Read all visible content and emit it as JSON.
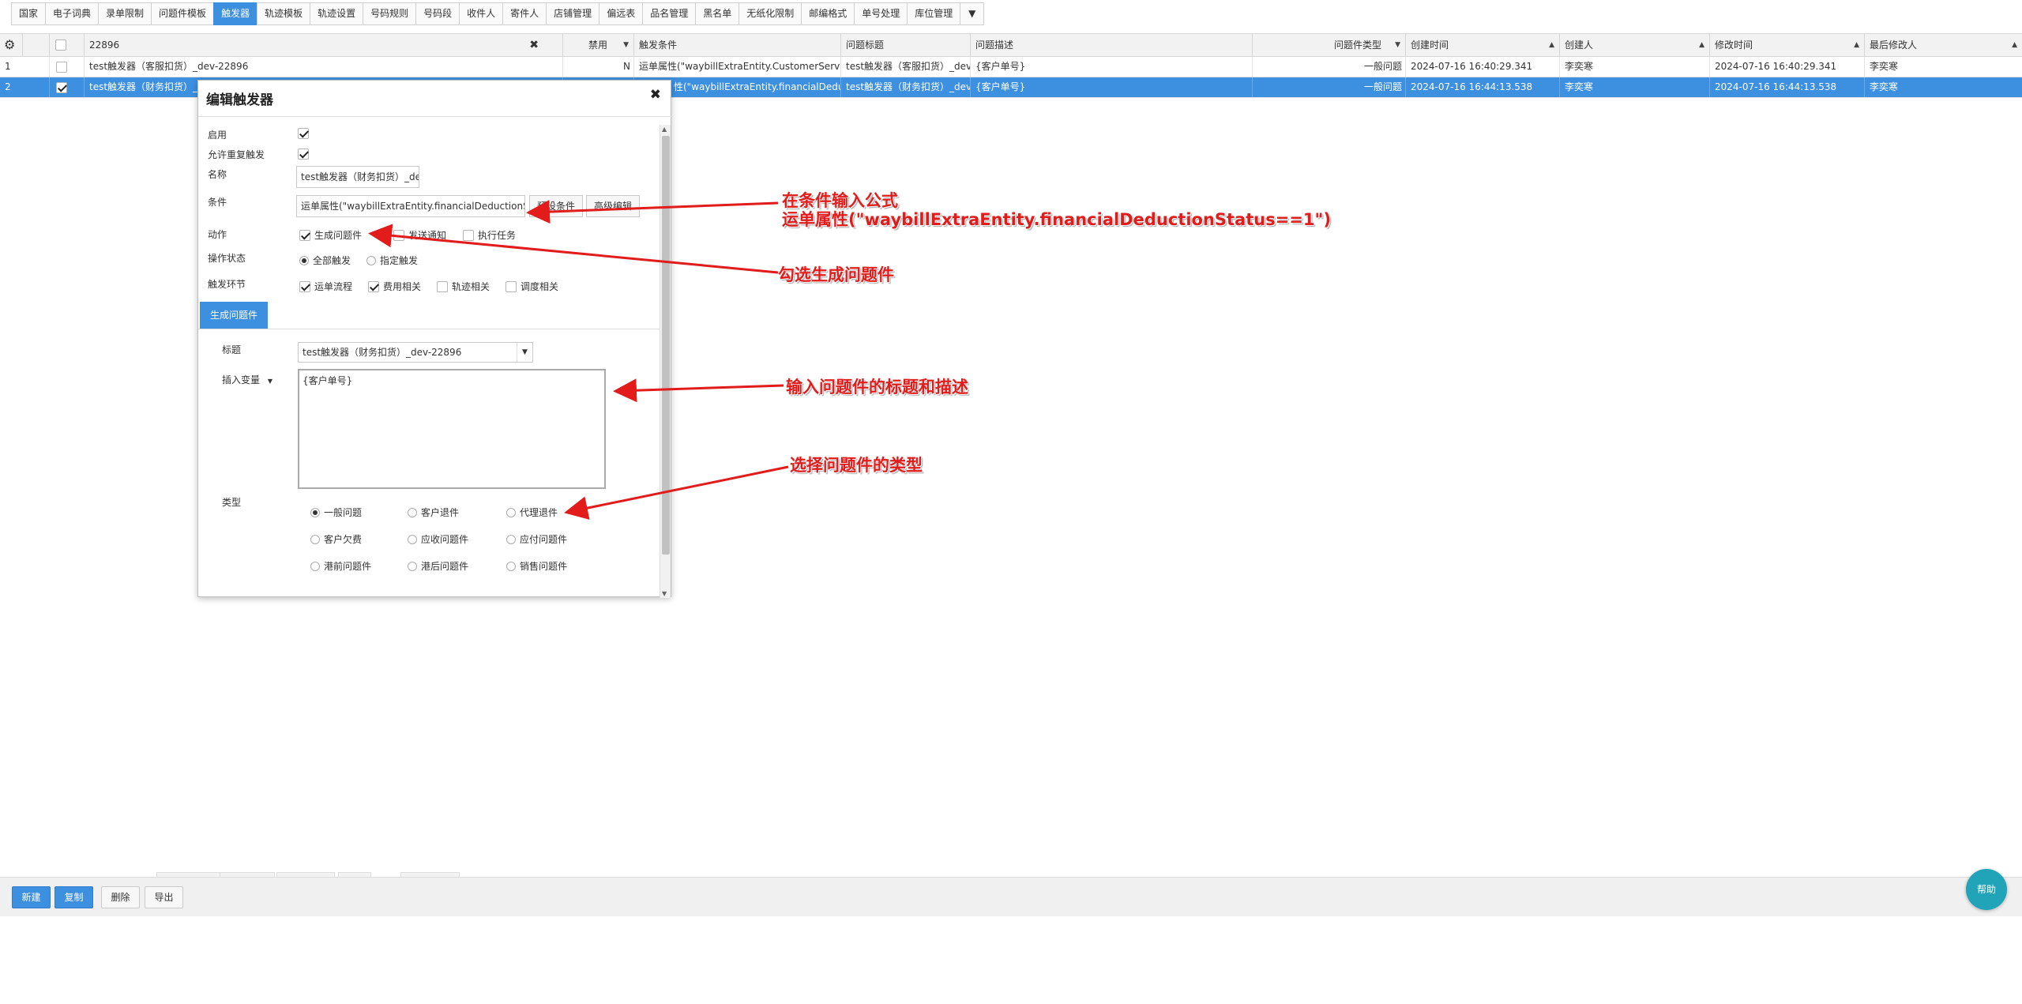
{
  "tabs": [
    {
      "label": "国家",
      "active": false
    },
    {
      "label": "电子词典",
      "active": false
    },
    {
      "label": "录单限制",
      "active": false
    },
    {
      "label": "问题件模板",
      "active": false
    },
    {
      "label": "触发器",
      "active": true
    },
    {
      "label": "轨迹模板",
      "active": false
    },
    {
      "label": "轨迹设置",
      "active": false
    },
    {
      "label": "号码规则",
      "active": false
    },
    {
      "label": "号码段",
      "active": false
    },
    {
      "label": "收件人",
      "active": false
    },
    {
      "label": "寄件人",
      "active": false
    },
    {
      "label": "店铺管理",
      "active": false
    },
    {
      "label": "偏远表",
      "active": false
    },
    {
      "label": "品名管理",
      "active": false
    },
    {
      "label": "黑名单",
      "active": false
    },
    {
      "label": "无纸化限制",
      "active": false
    },
    {
      "label": "邮编格式",
      "active": false
    },
    {
      "label": "单号处理",
      "active": false
    },
    {
      "label": "库位管理",
      "active": false
    }
  ],
  "grid": {
    "search_value": "22896",
    "columns": {
      "disabled": "禁用",
      "condition": "触发条件",
      "title": "问题标题",
      "description": "问题描述",
      "type": "问题件类型",
      "created_at": "创建时间",
      "creator": "创建人",
      "modified_at": "修改时间",
      "modifier": "最后修改人"
    },
    "rows": [
      {
        "num": "1",
        "name": "test触发器（客服扣货）_dev-22896",
        "disabled": "N",
        "condition": "运单属性(\"waybillExtraEntity.CustomerServiceDe",
        "title": "test触发器（客服扣货）_dev-",
        "description": "{客户单号}",
        "type": "一般问题",
        "created_at": "2024-07-16 16:40:29.341",
        "creator": "李奕寒",
        "modified_at": "2024-07-16 16:40:29.341",
        "modifier": "李奕寒"
      },
      {
        "num": "2",
        "name": "test触发器（财务扣货）_de",
        "disabled": "",
        "condition": "性(\"waybillExtraEntity.financialDeduction",
        "title": "test触发器（财务扣货）_dev-",
        "description": "{客户单号}",
        "type": "一般问题",
        "created_at": "2024-07-16 16:44:13.538",
        "creator": "李奕寒",
        "modified_at": "2024-07-16 16:44:13.538",
        "modifier": "李奕寒"
      }
    ]
  },
  "dialog": {
    "title": "编辑触发器",
    "labels": {
      "enable": "启用",
      "allow_repeat": "允许重复触发",
      "name": "名称",
      "condition": "条件",
      "action": "动作",
      "op_status": "操作状态",
      "trigger_stage": "触发环节",
      "subject": "标题",
      "type": "类型"
    },
    "name_value": "test触发器（财务扣货）_de",
    "condition_value": "运单属性(\"waybillExtraEntity.financialDeductionStatu",
    "preset_button": "预设条件",
    "advanced_button": "高级编辑",
    "actions": [
      {
        "label": "生成问题件",
        "checked": true
      },
      {
        "label": "发送通知",
        "checked": false
      },
      {
        "label": "执行任务",
        "checked": false
      }
    ],
    "op_status_options": [
      {
        "label": "全部触发",
        "checked": true
      },
      {
        "label": "指定触发",
        "checked": false
      }
    ],
    "stages": [
      {
        "label": "运单流程",
        "checked": true
      },
      {
        "label": "费用相关",
        "checked": true
      },
      {
        "label": "轨迹相关",
        "checked": false
      },
      {
        "label": "调度相关",
        "checked": false
      }
    ],
    "subtab": "生成问题件",
    "subject_value": "test触发器（财务扣货）_dev-22896",
    "insert_variable": "插入变量",
    "description_value": "{客户单号}",
    "types": [
      {
        "label": "一般问题",
        "checked": true
      },
      {
        "label": "客户退件",
        "checked": false
      },
      {
        "label": "代理退件",
        "checked": false
      },
      {
        "label": "客户欠费",
        "checked": false
      },
      {
        "label": "应收问题件",
        "checked": false
      },
      {
        "label": "应付问题件",
        "checked": false
      },
      {
        "label": "港前问题件",
        "checked": false
      },
      {
        "label": "港后问题件",
        "checked": false
      },
      {
        "label": "销售问题件",
        "checked": false
      }
    ]
  },
  "annotations": {
    "a1_line1": "在条件输入公式",
    "a1_line2": "运单属性(\"waybillExtraEntity.financialDeductionStatus==1\")",
    "a2": "勾选生成问题件",
    "a3": "输入问题件的标题和描述",
    "a4": "选择问题件的类型",
    "color": "#e21b1b"
  },
  "bottom": {
    "new": "新建",
    "copy": "复制",
    "delete": "删除",
    "export": "导出",
    "help": "帮助"
  },
  "colors": {
    "accent": "#3d8fe0",
    "help": "#21a3b8"
  }
}
